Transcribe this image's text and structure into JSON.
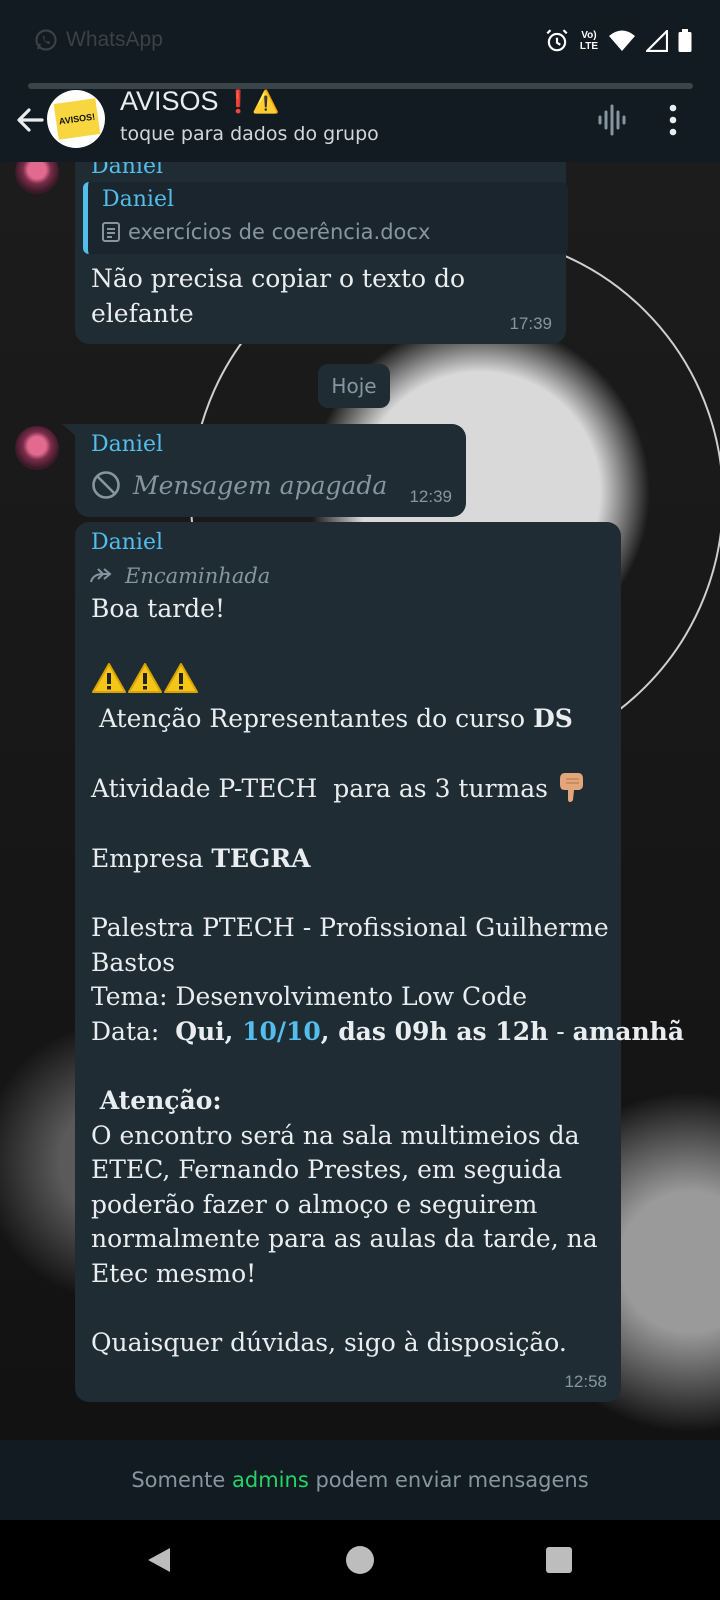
{
  "status_bar": {
    "app_label": "WhatsApp",
    "network": "LTE"
  },
  "header": {
    "group_name": "AVISOS",
    "group_emojis": "❗⚠️",
    "subtitle": "toque para dados do grupo",
    "avatar_text": "AVISOS!"
  },
  "messages": [
    {
      "sender": "Daniel",
      "reply_sender": "Daniel",
      "reply_attachment": "exercícios de coerência.docx",
      "text": "Não precisa copiar o texto do elefante",
      "time": "17:39"
    },
    {
      "sender": "Daniel",
      "text": "Mensagem apagada",
      "time": "12:39"
    },
    {
      "sender": "Daniel",
      "forwarded_label": "Encaminhada",
      "lines": {
        "greeting": "Boa tarde!",
        "attention_pre": " Atenção Representantes do curso ",
        "attention_course": "DS",
        "activity": "Atividade P-TECH  para as 3 turmas",
        "company_label": "Empresa ",
        "company_name": "TEGRA",
        "talk": "Palestra PTECH - Profissional Guilherme Bastos",
        "topic": "Tema: Desenvolvimento Low Code",
        "date_label": "Data:  ",
        "date_day": "Qui, ",
        "date_value": "10/10",
        "date_rest": ", das 09h as 12h",
        "date_sep": " - ",
        "date_tomorrow": "amanhã",
        "notice_title": " Atenção:",
        "notice_body": "O encontro será na sala multimeios da ETEC, Fernando Prestes, em seguida poderão fazer o almoço e seguirem normalmente para as aulas da tarde, na Etec mesmo!",
        "closing": "Quaisquer dúvidas, sigo à disposição."
      },
      "time": "12:58"
    }
  ],
  "day_divider": "Hoje",
  "footer": {
    "pre": "Somente ",
    "admins": "admins",
    "post": " podem enviar mensagens"
  },
  "colors": {
    "accent_blue": "#53bdeb",
    "admin_green": "#25d366",
    "bubble": "#1f2c34",
    "header": "#111b21"
  }
}
